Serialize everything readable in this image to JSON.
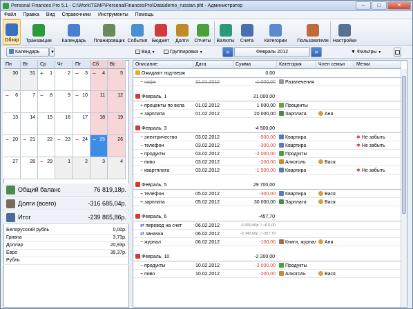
{
  "window": {
    "title": "Personal Finances Pro 5.1 - C:\\Work\\TEMP\\PersonalFinancesPro\\Data\\demo_russian.pfd - Администратор"
  },
  "menu": [
    "Файл",
    "Правка",
    "Вид",
    "Справочники",
    "Инструменты",
    "Помощь"
  ],
  "toolbar": [
    {
      "label": "Обзор",
      "icon": "overview-icon",
      "color": "#3b6fc4"
    },
    {
      "label": "Транзакции",
      "icon": "transactions-icon",
      "color": "#2d9a3a"
    },
    {
      "label": "Календарь",
      "icon": "calendar-icon",
      "color": "#4a7fd0"
    },
    {
      "label": "Планировщик",
      "icon": "scheduler-icon",
      "color": "#6a8a5a"
    },
    {
      "label": "События",
      "icon": "events-icon",
      "color": "#4a8fd0"
    },
    {
      "label": "Бюджет",
      "icon": "budget-icon",
      "color": "#d03a3a"
    },
    {
      "label": "Долги",
      "icon": "debts-icon",
      "color": "#c08a2a"
    },
    {
      "label": "Отчеты",
      "icon": "reports-icon",
      "color": "#4aa03a"
    },
    {
      "label": "Валюты",
      "icon": "currencies-icon",
      "color": "#2a9a7a"
    },
    {
      "label": "Счета",
      "icon": "accounts-icon",
      "color": "#4a6fb0"
    },
    {
      "label": "Категории",
      "icon": "categories-icon",
      "color": "#5a8ad0"
    },
    {
      "label": "Пользователи",
      "icon": "users-icon",
      "color": "#c06a3a"
    },
    {
      "label": "Настройки",
      "icon": "settings-icon",
      "color": "#5a7090"
    }
  ],
  "subbar": {
    "calendar": "Календарь",
    "view": "Вид",
    "group": "Группировка",
    "month": "Февраль 2012",
    "filters": "Фильтры"
  },
  "calendar": {
    "days": [
      "Пн",
      "Вт",
      "Ср",
      "Чт",
      "Пт",
      "Сб",
      "Вс"
    ],
    "weeks": [
      [
        {
          "n": "30",
          "m": "",
          "t": "other"
        },
        {
          "n": "31",
          "m": "",
          "t": "other"
        },
        {
          "n": "1",
          "m": "+",
          "t": ""
        },
        {
          "n": "2",
          "m": "",
          "t": ""
        },
        {
          "n": "3",
          "m": "-",
          "t": ""
        },
        {
          "n": "4",
          "m": "-",
          "t": "we"
        },
        {
          "n": "5",
          "m": "",
          "t": "we"
        }
      ],
      [
        {
          "n": "6",
          "m": "-",
          "t": ""
        },
        {
          "n": "7",
          "m": "",
          "t": ""
        },
        {
          "n": "8",
          "m": "-",
          "t": ""
        },
        {
          "n": "9",
          "m": "",
          "t": ""
        },
        {
          "n": "10",
          "m": "-",
          "t": ""
        },
        {
          "n": "11",
          "m": "",
          "t": "we"
        },
        {
          "n": "12",
          "m": "",
          "t": "we"
        }
      ],
      [
        {
          "n": "13",
          "m": "",
          "t": ""
        },
        {
          "n": "14",
          "m": "",
          "t": ""
        },
        {
          "n": "15",
          "m": "",
          "t": ""
        },
        {
          "n": "16",
          "m": "",
          "t": ""
        },
        {
          "n": "17",
          "m": "",
          "t": ""
        },
        {
          "n": "18",
          "m": "",
          "t": "we"
        },
        {
          "n": "19",
          "m": "",
          "t": "we"
        }
      ],
      [
        {
          "n": "20",
          "m": "-",
          "t": ""
        },
        {
          "n": "21",
          "m": "-",
          "t": ""
        },
        {
          "n": "22",
          "m": "",
          "t": ""
        },
        {
          "n": "23",
          "m": "-",
          "t": ""
        },
        {
          "n": "24",
          "m": "-",
          "t": ""
        },
        {
          "n": "25",
          "m": "-",
          "t": "today"
        },
        {
          "n": "26",
          "m": "",
          "t": "we"
        }
      ],
      [
        {
          "n": "27",
          "m": "",
          "t": ""
        },
        {
          "n": "28",
          "m": "",
          "t": ""
        },
        {
          "n": "29",
          "m": "-",
          "t": ""
        },
        {
          "n": "1",
          "m": "",
          "t": "other"
        },
        {
          "n": "2",
          "m": "",
          "t": "other"
        },
        {
          "n": "3",
          "m": "",
          "t": "other"
        },
        {
          "n": "4",
          "m": "",
          "t": "other"
        }
      ]
    ]
  },
  "balances": [
    {
      "label": "Общий баланс",
      "value": "76 819,18р.",
      "icon": "balance-icon",
      "color": "#4a8a4a"
    },
    {
      "label": "Долги (всего)",
      "value": "-316 685,04р.",
      "icon": "debts-total-icon",
      "color": "#7a6a5a"
    },
    {
      "label": "Итог",
      "value": "-239 865,86р.",
      "icon": "total-icon",
      "color": "#4a6a9a"
    }
  ],
  "currencies": [
    {
      "name": "Белорусский рубль",
      "value": "0,00р."
    },
    {
      "name": "Гривна",
      "value": "3,73р."
    },
    {
      "name": "Доллар",
      "value": "20,93р."
    },
    {
      "name": "Евро",
      "value": "39,37р."
    },
    {
      "name": "Рубль",
      "value": ""
    }
  ],
  "columns": [
    "Описание",
    "Дата",
    "Сумма",
    "Категория",
    "Член семьи",
    "Метки"
  ],
  "rows": [
    {
      "type": "group",
      "desc": "Ожидают подтверж",
      "amount": "0,00",
      "warn": true
    },
    {
      "type": "item",
      "sign": "-",
      "desc": "кафе",
      "date": "31.01.2012",
      "amount": "-1 000,00",
      "cat": "Развлечения",
      "member": "",
      "tag": "",
      "strike": true
    },
    {
      "type": "group",
      "desc": "Февраль, 1",
      "amount": "21 000,00"
    },
    {
      "type": "item",
      "sign": "+",
      "desc": "проценты по вкла",
      "date": "01.02.2012",
      "amount": "1 000,00",
      "cat": "Проценты",
      "member": "",
      "tag": ""
    },
    {
      "type": "item",
      "sign": "+",
      "desc": "зарплата",
      "date": "01.02.2012",
      "amount": "20 000,00",
      "cat": "Зарплата",
      "member": "Аня",
      "tag": ""
    },
    {
      "type": "group",
      "desc": "Февраль, 3",
      "amount": "-4 500,00"
    },
    {
      "type": "item",
      "sign": "-",
      "desc": "электричество",
      "date": "03.02.2012",
      "amount": "-500,00",
      "cat": "Квартира",
      "member": "",
      "tag": "Не забыть"
    },
    {
      "type": "item",
      "sign": "-",
      "desc": "телефон",
      "date": "03.02.2012",
      "amount": "-300,00",
      "cat": "Квартира",
      "member": "",
      "tag": "Не забыть"
    },
    {
      "type": "item",
      "sign": "-",
      "desc": "продукты",
      "date": "03.02.2012",
      "amount": "-2 000,00",
      "cat": "Продукты",
      "member": "",
      "tag": ""
    },
    {
      "type": "item",
      "sign": "-",
      "desc": "пиво",
      "date": "03.02.2012",
      "amount": "-200,00",
      "cat": "Алкоголь",
      "member": "Вася",
      "tag": ""
    },
    {
      "type": "item",
      "sign": "-",
      "desc": "квартплата",
      "date": "03.02.2012",
      "amount": "-1 500,00",
      "cat": "Квартира",
      "member": "",
      "tag": "Не забыть"
    },
    {
      "type": "group",
      "desc": "Февраль, 5",
      "amount": "29 700,00"
    },
    {
      "type": "item",
      "sign": "-",
      "desc": "телефон",
      "date": "05.02.2012",
      "amount": "-300,00",
      "cat": "Квартира",
      "member": "Вася",
      "tag": ""
    },
    {
      "type": "item",
      "sign": "+",
      "desc": "зарплата",
      "date": "05.02.2012",
      "amount": "30 000,00",
      "cat": "Зарплата",
      "member": "Вася",
      "tag": ""
    },
    {
      "type": "group",
      "desc": "Февраль, 6",
      "amount": "-457,70"
    },
    {
      "type": "item",
      "sign": "t",
      "desc": "перевод на счет",
      "date": "06.02.2012",
      "amount": "-6 000,00р. / +6 0,00",
      "cat": "",
      "member": "",
      "tag": "",
      "gray": true
    },
    {
      "type": "item",
      "sign": "t",
      "desc": "заначка",
      "date": "06.02.2012",
      "amount": "-6 343,60р. / -357,70",
      "cat": "",
      "member": "",
      "tag": "",
      "gray": true
    },
    {
      "type": "item",
      "sign": "-",
      "desc": "журнал",
      "date": "06.02.2012",
      "amount": "-100,00",
      "cat": "Книги, журнал",
      "member": "Аня",
      "tag": ""
    },
    {
      "type": "group",
      "desc": "Февраль, 10",
      "amount": "-2 200,00"
    },
    {
      "type": "item",
      "sign": "-",
      "desc": "продукты",
      "date": "10.02.2012",
      "amount": "-2 000,00",
      "cat": "Продукты",
      "member": "",
      "tag": ""
    },
    {
      "type": "item",
      "sign": "-",
      "desc": "пиво",
      "date": "10.02.2012",
      "amount": "-200,00",
      "cat": "Алкоголь",
      "member": "Вася",
      "tag": ""
    }
  ],
  "colors": {
    "income": "#2c9a2c",
    "expense": "#d63a2a",
    "weekend": "#f6d6d8",
    "today": "#3c8de8",
    "tag": "#d63a2a"
  }
}
